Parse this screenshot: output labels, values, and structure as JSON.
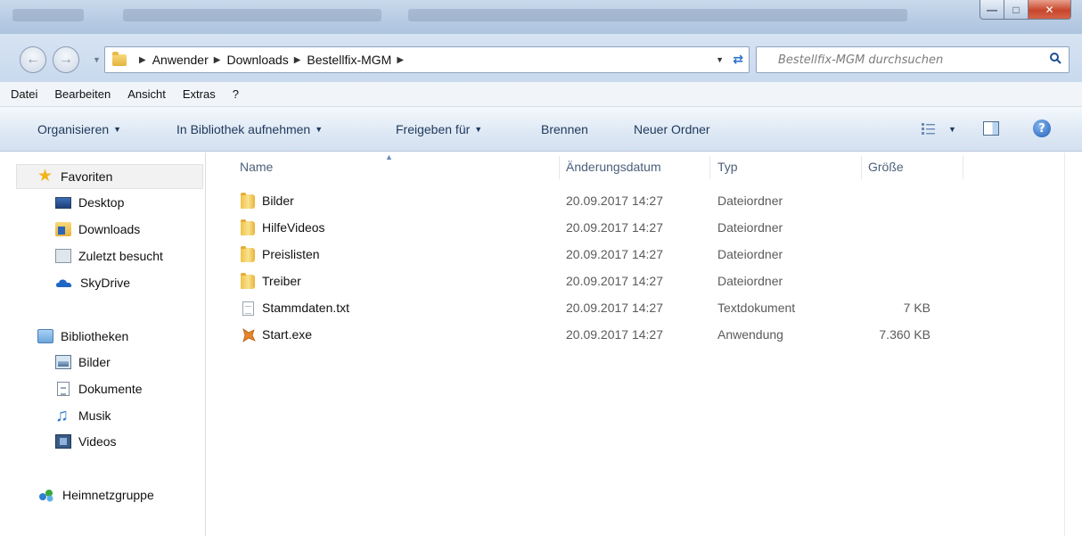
{
  "address": {
    "breadcrumbs": [
      "Anwender",
      "Downloads",
      "Bestellfix-MGM"
    ]
  },
  "search": {
    "placeholder": "Bestellfix-MGM durchsuchen"
  },
  "menubar": {
    "items": [
      "Datei",
      "Bearbeiten",
      "Ansicht",
      "Extras",
      "?"
    ]
  },
  "toolbar": {
    "organize": "Organisieren",
    "add_to_library": "In Bibliothek aufnehmen",
    "share_with": "Freigeben für",
    "burn": "Brennen",
    "new_folder": "Neuer Ordner"
  },
  "sidebar": {
    "favorites": {
      "label": "Favoriten",
      "items": [
        "Desktop",
        "Downloads",
        "Zuletzt besucht",
        "SkyDrive"
      ]
    },
    "libraries": {
      "label": "Bibliotheken",
      "items": [
        "Bilder",
        "Dokumente",
        "Musik",
        "Videos"
      ]
    },
    "homegroup": "Heimnetzgruppe"
  },
  "columns": {
    "name": "Name",
    "date": "Änderungsdatum",
    "type": "Typ",
    "size": "Größe"
  },
  "files": [
    {
      "name": "Bilder",
      "date": "20.09.2017 14:27",
      "type": "Dateiordner",
      "size": "",
      "icon": "folder-icon"
    },
    {
      "name": "HilfeVideos",
      "date": "20.09.2017 14:27",
      "type": "Dateiordner",
      "size": "",
      "icon": "folder-icon"
    },
    {
      "name": "Preislisten",
      "date": "20.09.2017 14:27",
      "type": "Dateiordner",
      "size": "",
      "icon": "folder-icon"
    },
    {
      "name": "Treiber",
      "date": "20.09.2017 14:27",
      "type": "Dateiordner",
      "size": "",
      "icon": "folder-icon"
    },
    {
      "name": "Stammdaten.txt",
      "date": "20.09.2017 14:27",
      "type": "Textdokument",
      "size": "7 KB",
      "icon": "text-file-icon"
    },
    {
      "name": "Start.exe",
      "date": "20.09.2017 14:27",
      "type": "Anwendung",
      "size": "7.360 KB",
      "icon": "application-icon"
    }
  ]
}
